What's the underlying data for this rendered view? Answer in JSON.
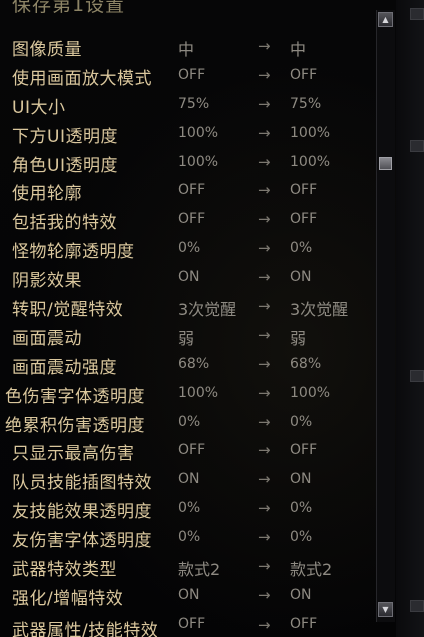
{
  "header": {
    "title": "保存第1设置"
  },
  "settings": [
    {
      "label": "图像质量",
      "current": "中",
      "new": "中",
      "cjk": true
    },
    {
      "label": "使用画面放大模式",
      "current": "OFF",
      "new": "OFF"
    },
    {
      "label": "UI大小",
      "current": "75%",
      "new": "75%"
    },
    {
      "label": "下方UI透明度",
      "current": "100%",
      "new": "100%"
    },
    {
      "label": "角色UI透明度",
      "current": "100%",
      "new": "100%"
    },
    {
      "label": "使用轮廓",
      "current": "OFF",
      "new": "OFF"
    },
    {
      "label": "包括我的特效",
      "current": "OFF",
      "new": "OFF"
    },
    {
      "label": "怪物轮廓透明度",
      "current": "0%",
      "new": "0%"
    },
    {
      "label": "阴影效果",
      "current": "ON",
      "new": "ON"
    },
    {
      "label": "转职/觉醒特效",
      "current": "3次觉醒",
      "new": "3次觉醒",
      "cjk": true
    },
    {
      "label": "画面震动",
      "current": "弱",
      "new": "弱",
      "cjk": true
    },
    {
      "label": "画面震动强度",
      "current": "68%",
      "new": "68%"
    },
    {
      "label": "色伤害字体透明度",
      "current": "100%",
      "new": "100%",
      "clip": true
    },
    {
      "label": "绝累积伤害透明度",
      "current": "0%",
      "new": "0%",
      "clip": true
    },
    {
      "label": "只显示最高伤害",
      "current": "OFF",
      "new": "OFF"
    },
    {
      "label": "队员技能插图特效",
      "current": "ON",
      "new": "ON"
    },
    {
      "label": "友技能效果透明度",
      "current": "0%",
      "new": "0%"
    },
    {
      "label": "友伤害字体透明度",
      "current": "0%",
      "new": "0%"
    },
    {
      "label": "武器特效类型",
      "current": "款式2",
      "new": "款式2",
      "cjk": true
    },
    {
      "label": "强化/增幅特效",
      "current": "ON",
      "new": "ON"
    }
  ],
  "partial_row": {
    "label": "武器属性/技能特效",
    "current": "OFF",
    "new": "OFF"
  },
  "arrow_glyph": "→",
  "scrollbar": {
    "position": 0.23
  },
  "colors": {
    "label": "#dac79d",
    "value": "#8e8a82",
    "background": "#050506"
  }
}
